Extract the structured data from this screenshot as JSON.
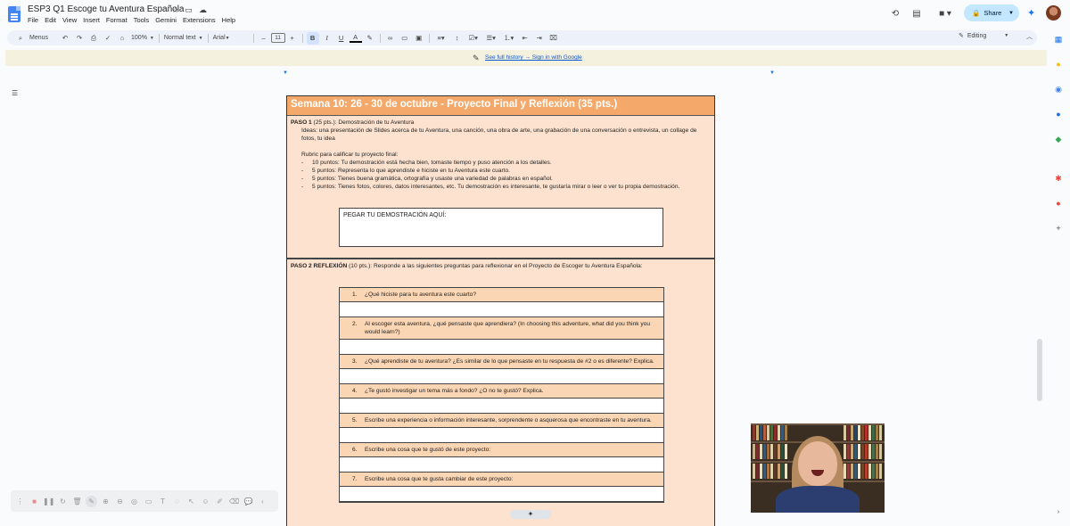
{
  "app": {
    "doc_title": "ESP3 Q1 Escoge tu Aventura Española",
    "menu": [
      "File",
      "Edit",
      "View",
      "Insert",
      "Format",
      "Tools",
      "Gemini",
      "Extensions",
      "Help"
    ],
    "share_label": "Share"
  },
  "toolbar": {
    "menus_label": "Menus",
    "zoom": "100%",
    "style": "Normal text",
    "font": "Arial",
    "font_size": "11",
    "editing_label": "Editing"
  },
  "banner": {
    "history_link": "See full history → Sign in with Google"
  },
  "document": {
    "week_header": "Semana 10: 26 - 30 de octubre - Proyecto Final y Reflexión (35 pts.)",
    "paso1": {
      "title": "PASO 1",
      "title_rest": " (25 pts.): Demostración de tu Aventura",
      "ideas": "Ideas: una presentación de Slides acerca de tu Aventura, una canción, una obra de arte, una grabación de una conversación o entrevista, un collage de fotos, tu idea",
      "rubric_title": "Rubric para calificar tu proyecto final:",
      "rubric": [
        "10 puntos: Tu demostración está hecha bien, tomaste tiempo y puso atención a los detalles.",
        "5 puntos: Representa lo que aprendiste e hiciste en tu Aventura este cuarto.",
        "5 puntos: Tienes buena gramática, ortografía y usaste una variedad de palabras en español.",
        "5 puntos: Tienes fotos, colores, datos interesantes, etc. Tu demostración es interesante, te gustaría mirar o leer o ver tu propia demostración."
      ],
      "paste_box": "PEGAR TU DEMOSTRACIÓN AQUÍ:"
    },
    "paso2": {
      "title": "PASO 2 REFLEXIÓN",
      "title_rest": " (10 pts.): Responde a las siguientes preguntas para reflexionar en el Proyecto de Escoger tu Aventura Española:",
      "questions": [
        {
          "num": "1.",
          "text": "¿Qué hiciste para tu aventura este cuarto?"
        },
        {
          "num": "2.",
          "text": "Al escoger esta aventura, ¿qué pensaste que aprendiera? (In choosing this adventure, what did you think you would learn?)"
        },
        {
          "num": "3.",
          "text": "¿Qué aprendiste de tu aventura? ¿Es similar de lo que pensaste en tu respuesta de #2 o es diferente? Explica."
        },
        {
          "num": "4.",
          "text": "¿Te gustó investigar un tema más a fondo? ¿O no te gustó? Explica."
        },
        {
          "num": "5.",
          "text": "Escribe una experiencia o información interesante, sorprendente o asquerosa que encontraste en tu aventura."
        },
        {
          "num": "6.",
          "text": "Escribe una cosa que te gustó de este proyecto:"
        },
        {
          "num": "7.",
          "text": "Escribe una cosa que te gusta cambiar de este proyecto:"
        }
      ]
    }
  },
  "colors": {
    "header_orange": "#f4a96a",
    "table_bg": "#fde3cf",
    "question_bg": "#fbd6b4",
    "share_bg": "#c2e7ff",
    "link_blue": "#0b57d0"
  }
}
